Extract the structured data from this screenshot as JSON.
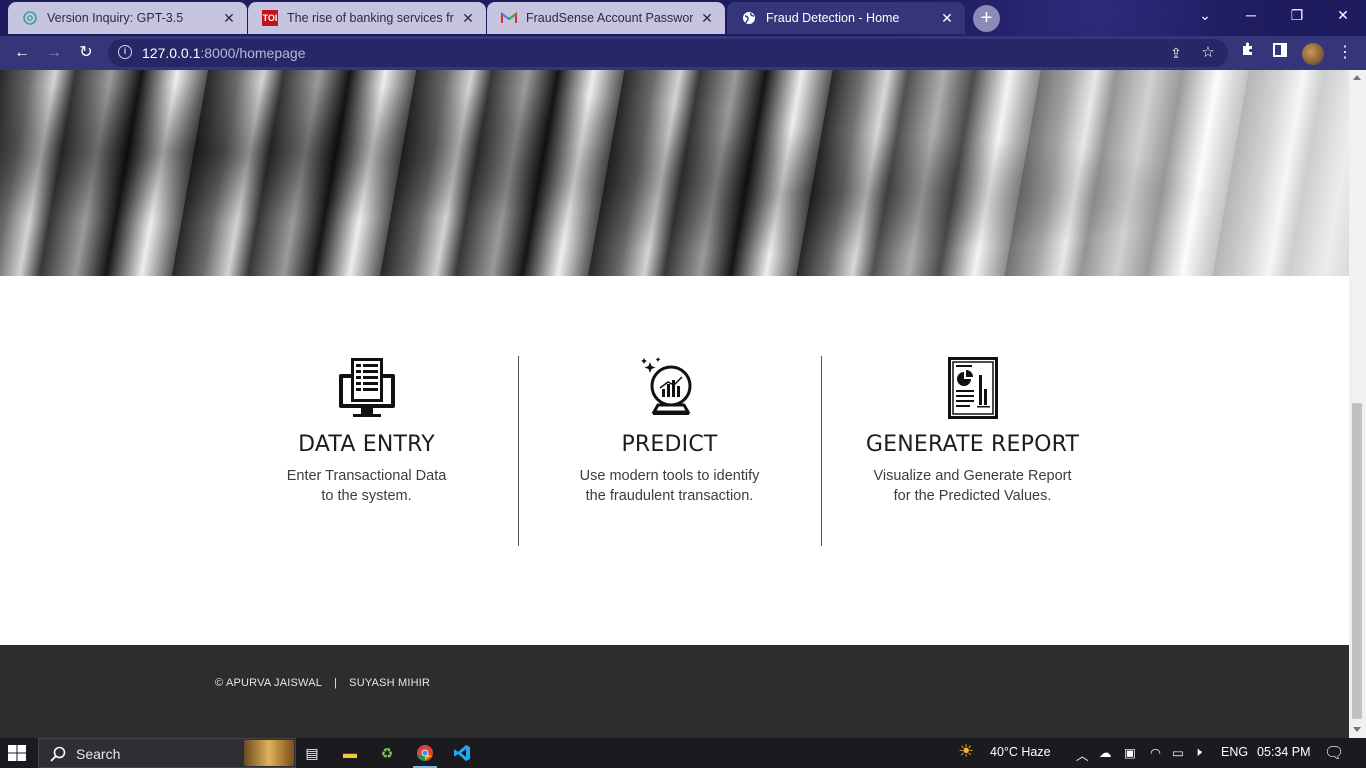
{
  "browser": {
    "tabs": [
      {
        "title": "Version Inquiry: GPT-3.5",
        "favicon": "openai-icon",
        "active": false
      },
      {
        "title": "The rise of banking services frauc",
        "favicon": "toi-icon",
        "favicon_text": "TOI",
        "active": false
      },
      {
        "title": "FraudSense Account Password Cl",
        "favicon": "gmail-icon",
        "active": false
      },
      {
        "title": "Fraud Detection - Home",
        "favicon": "globe-icon",
        "active": true
      }
    ],
    "url_host": "127.0.0.1",
    "url_rest": ":8000/homepage"
  },
  "features": [
    {
      "title": "DATA ENTRY",
      "line1": "Enter Transactional Data",
      "line2": "to the system.",
      "icon": "computer-form-icon"
    },
    {
      "title": "PREDICT",
      "line1": "Use modern tools to identify",
      "line2": "the fraudulent transaction.",
      "icon": "crystal-ball-chart-icon"
    },
    {
      "title": "GENERATE REPORT",
      "line1": "Visualize and Generate Report",
      "line2": "for the Predicted Values.",
      "icon": "report-chart-icon"
    }
  ],
  "footer": {
    "author1": "© APURVA JAISWAL",
    "separator": "|",
    "author2": "SUYASH MIHIR"
  },
  "taskbar": {
    "search_label": "Search",
    "weather": "40°C  Haze",
    "language": "ENG",
    "time": "05:34 PM"
  },
  "colors": {
    "tab_strip": "#1e1b5e",
    "toolbar": "#35367a",
    "footer_bg": "#2d2d2d"
  }
}
